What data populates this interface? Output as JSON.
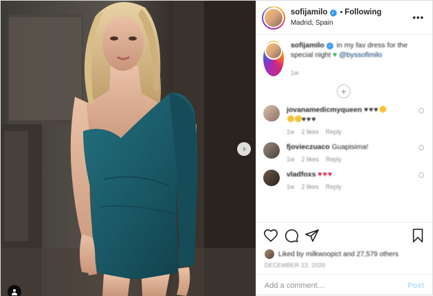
{
  "header": {
    "username": "sofijamilo",
    "separator": "•",
    "follow_status": "Following",
    "location": "Madrid, Spain",
    "more_icon": "more-options-icon"
  },
  "caption": {
    "username": "sofijamilo",
    "text": "in my fav dress for the special night",
    "mention": "@byssofimilo",
    "time": "1w"
  },
  "load_more_icon": "plus-circle-icon",
  "comments": [
    {
      "username": "jovanamedicmyqueen",
      "text_hearts": "♥♥♥",
      "line2_hearts": "♥♥♥",
      "time": "1w",
      "likes": "2 likes",
      "reply": "Reply"
    },
    {
      "username": "fjovieczuaco",
      "text": "Guapisima!",
      "time": "1w",
      "likes": "2 likes",
      "reply": "Reply"
    },
    {
      "username": "vladfoxs",
      "text_hearts": "♥♥♥",
      "time": "1w",
      "likes": "2 likes",
      "reply": "Reply"
    }
  ],
  "actions": {
    "like_icon": "heart-icon",
    "comment_icon": "comment-icon",
    "share_icon": "share-icon",
    "save_icon": "bookmark-icon"
  },
  "likes": {
    "text": "Liked by milkwoopict and 27,579 others"
  },
  "date": "DECEMBER 22, 2020",
  "add_comment": {
    "placeholder": "Add a comment…",
    "post_label": "Post"
  },
  "colors": {
    "accent_blue": "#3897f0",
    "dress_teal": "#1c5a66",
    "post_disabled": "#b2dffc"
  }
}
